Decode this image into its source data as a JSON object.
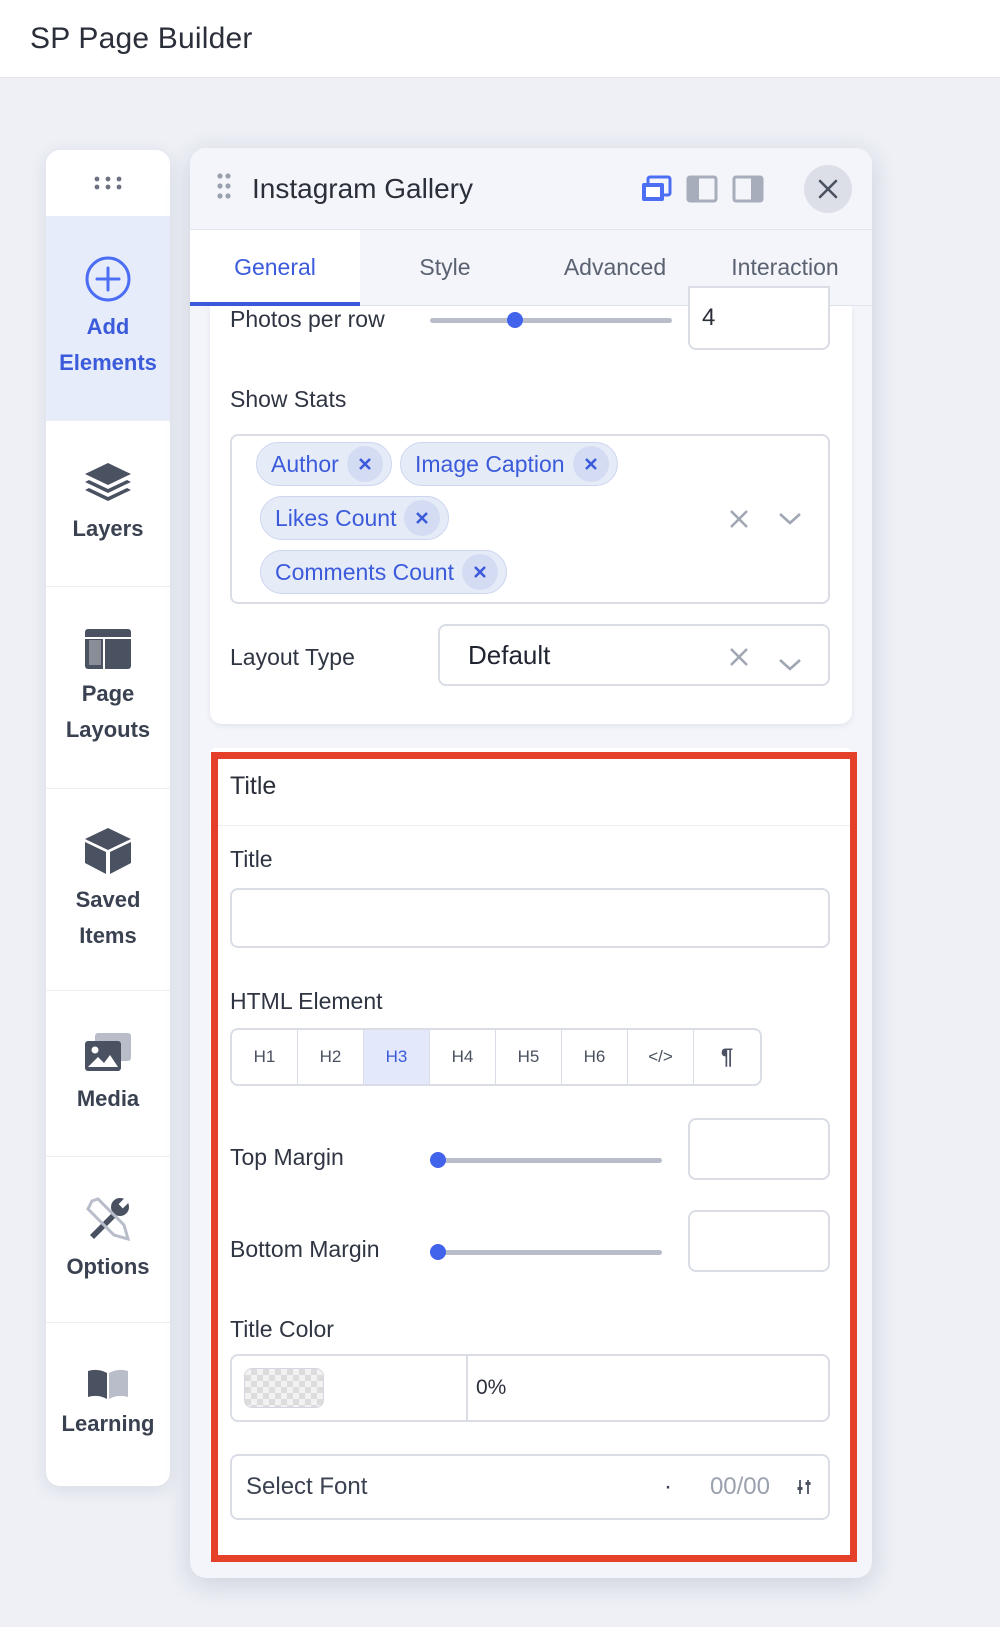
{
  "app": {
    "title": "SP Page Builder"
  },
  "sidebar": {
    "items": [
      {
        "label": "Add Elements",
        "icon": "plus-circle-icon"
      },
      {
        "label": "Layers",
        "icon": "layers-icon"
      },
      {
        "label": "Page Layouts",
        "icon": "layout-icon"
      },
      {
        "label": "Saved Items",
        "icon": "box-icon"
      },
      {
        "label": "Media",
        "icon": "images-icon"
      },
      {
        "label": "Options",
        "icon": "tools-icon"
      },
      {
        "label": "Learning",
        "icon": "book-icon"
      }
    ]
  },
  "panel": {
    "title": "Instagram Gallery",
    "tabs": [
      "General",
      "Style",
      "Advanced",
      "Interaction"
    ],
    "active_tab": "General"
  },
  "general": {
    "photos_per_row": {
      "label": "Photos per row",
      "value": "4",
      "slider_fraction": 0.35
    },
    "show_stats": {
      "label": "Show Stats",
      "tags": [
        "Author",
        "Image Caption",
        "Likes Count",
        "Comments Count"
      ]
    },
    "layout_type": {
      "label": "Layout Type",
      "value": "Default"
    }
  },
  "title_section": {
    "heading": "Title",
    "title_field": {
      "label": "Title",
      "value": ""
    },
    "html_element": {
      "label": "HTML Element",
      "options": [
        "H1",
        "H2",
        "H3",
        "H4",
        "H5",
        "H6",
        "</>",
        "¶"
      ],
      "selected": "H3"
    },
    "top_margin": {
      "label": "Top Margin",
      "value": "",
      "slider_fraction": 0.0
    },
    "bottom_margin": {
      "label": "Bottom Margin",
      "value": "",
      "slider_fraction": 0.0
    },
    "title_color": {
      "label": "Title Color",
      "opacity": "0%"
    },
    "font": {
      "placeholder": "Select Font",
      "size": "00/00"
    }
  },
  "colors": {
    "accent": "#3b5bdb",
    "highlight": "#e4402a"
  }
}
